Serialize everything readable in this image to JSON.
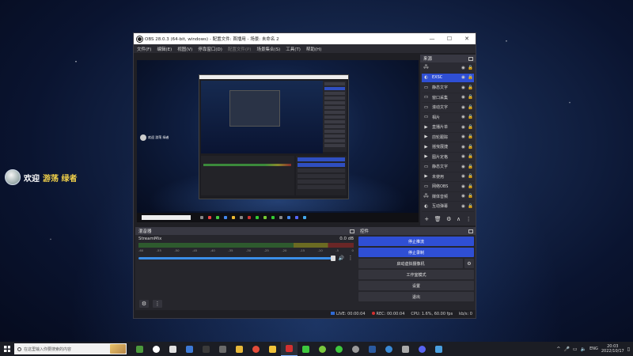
{
  "overlay": {
    "welcome": "欢迎",
    "name": "游荡 绿者"
  },
  "window": {
    "title": "OBS 28.0.3 (64-bit, windows) - 配置文件: 首播用 - 场景: 未命名 2",
    "controls": [
      "—",
      "☐",
      "✕"
    ]
  },
  "menu": [
    {
      "label": "文件(F)",
      "disabled": false
    },
    {
      "label": "编辑(E)",
      "disabled": false
    },
    {
      "label": "视图(V)",
      "disabled": false
    },
    {
      "label": "停靠窗口(D)",
      "disabled": false
    },
    {
      "label": "配置文件(P)",
      "disabled": true
    },
    {
      "label": "场景集合(S)",
      "disabled": false
    },
    {
      "label": "工具(T)",
      "disabled": false
    },
    {
      "label": "帮助(H)",
      "disabled": false
    }
  ],
  "preview": {
    "mini_chat": "欢迎 游荡 绿者"
  },
  "sources": {
    "title": "来源",
    "items": [
      {
        "icon": "🖧",
        "name": "",
        "selected": false
      },
      {
        "icon": "◐",
        "name": "EXSC",
        "selected": true
      },
      {
        "icon": "▭",
        "name": "静态文字",
        "selected": false
      },
      {
        "icon": "▭",
        "name": "窗口采集",
        "selected": false
      },
      {
        "icon": "▭",
        "name": "滚动文字",
        "selected": false
      },
      {
        "icon": "▭",
        "name": "相片",
        "selected": false
      },
      {
        "icon": "▶",
        "name": "直播片单",
        "selected": false
      },
      {
        "icon": "▶",
        "name": "前轮跟踪",
        "selected": false
      },
      {
        "icon": "▶",
        "name": "摇曳展捷",
        "selected": false
      },
      {
        "icon": "▶",
        "name": "图片定格",
        "selected": false
      },
      {
        "icon": "▭",
        "name": "静态文字",
        "selected": false
      },
      {
        "icon": "▶",
        "name": "未使用",
        "selected": false
      },
      {
        "icon": "▭",
        "name": "网络OBS",
        "selected": false
      },
      {
        "icon": "🖧",
        "name": "媒体音频",
        "selected": false
      },
      {
        "icon": "◐",
        "name": "互动弹幕",
        "selected": false
      }
    ],
    "footer": [
      "+",
      "🗑",
      "⚙",
      "∧",
      "⋮"
    ]
  },
  "mixer": {
    "title": "混音器",
    "channel": "StreamMix",
    "db": "0.0 dB",
    "ticks": [
      "-60",
      "-55",
      "-50",
      "-45",
      "-40",
      "-35",
      "-30",
      "-25",
      "-20",
      "-15",
      "-10",
      "-5",
      "0"
    ]
  },
  "controls": {
    "title": "控件",
    "buttons": [
      {
        "label": "停止推流",
        "active": true
      },
      {
        "label": "停止录制",
        "active": true
      }
    ],
    "virtual_cam": "启动虚拟摄像机",
    "buttons2": [
      "工作室模式",
      "设置",
      "退出"
    ]
  },
  "status": {
    "live": "LIVE: 00:00:04",
    "rec": "REC: 00:00:04",
    "cpu": "CPU: 1.6%, 60.00 fps",
    "kbps": "kb/s: 0"
  },
  "taskbar": {
    "search_placeholder": "在这里输入你要搜索的内容",
    "apps": [
      {
        "name": "xbox-icon",
        "color": "#4c9a3c"
      },
      {
        "name": "obs-app-icon",
        "color": "#ffffff"
      },
      {
        "name": "capcut-icon",
        "color": "#e0e0e0"
      },
      {
        "name": "steam-blue-icon",
        "color": "#3d7ad6"
      },
      {
        "name": "media-icon",
        "color": "#3a3a3a"
      },
      {
        "name": "window-icon",
        "color": "#6a6a6a"
      },
      {
        "name": "folder-icon",
        "color": "#e8b93a"
      },
      {
        "name": "chrome-icon",
        "color": "#e44c3a"
      },
      {
        "name": "notes-icon",
        "color": "#f0c23a"
      },
      {
        "name": "obs-running-icon",
        "color": "#d23030"
      },
      {
        "name": "chat-green-icon",
        "color": "#3ec83e"
      },
      {
        "name": "bean-icon",
        "color": "#7ac83e"
      },
      {
        "name": "wechat-icon",
        "color": "#3ec83e"
      },
      {
        "name": "settings-icon",
        "color": "#9a9a9a"
      },
      {
        "name": "steam-icon",
        "color": "#2a5aa0"
      },
      {
        "name": "browser-icon",
        "color": "#3a8ad6"
      },
      {
        "name": "audio-icon",
        "color": "#aaaaaa"
      },
      {
        "name": "discord-icon",
        "color": "#5865f2"
      },
      {
        "name": "network-icon",
        "color": "#4aa0e0"
      }
    ],
    "lang": "ENG",
    "time": "20:03",
    "date": "2022/10/17"
  }
}
